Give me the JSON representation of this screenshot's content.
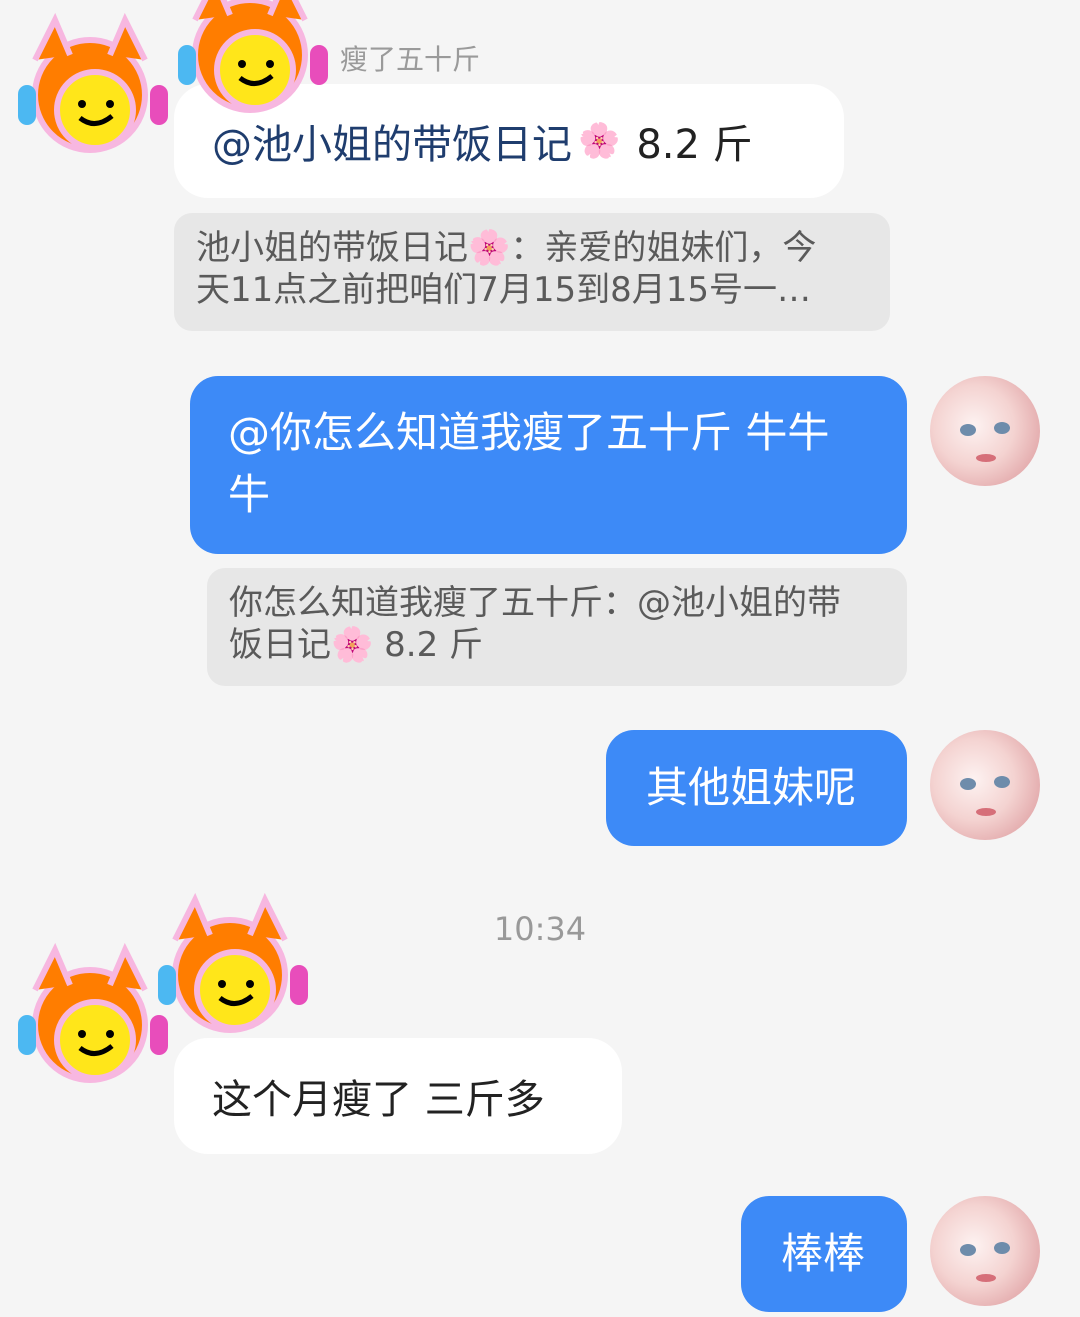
{
  "messages": {
    "top_snippet": "瘦了五十斤",
    "m1": {
      "mention": "@池小姐的带饭日记",
      "flower": "🌸",
      "value": "8.2 斤"
    },
    "q1": {
      "line1_pre": "池小姐的带饭日记",
      "flower": "🌸",
      "line1_post": "：亲爱的姐妹们，今",
      "line2": "天11点之前把咱们7月15到8月15号一…"
    },
    "m2": {
      "line1": "@你怎么知道我瘦了五十斤 牛牛",
      "line2": "牛"
    },
    "q2": {
      "line1": "你怎么知道我瘦了五十斤：@池小姐的带",
      "line2_pre": "饭日记",
      "flower": "🌸",
      "line2_post": " 8.2 斤"
    },
    "m3": {
      "text": "其他姐妹呢"
    },
    "timestamp": "10:34",
    "m4": {
      "text": "这个月瘦了 三斤多"
    },
    "m5": {
      "text": "棒棒"
    }
  },
  "colors": {
    "background": "#f5f5f5",
    "outgoing_bubble": "#3d8af7",
    "incoming_bubble": "#ffffff",
    "quote_bubble": "#e7e7e7"
  },
  "icons": {
    "sticker": "orange-hair-smiley-headphones-sticker",
    "avatar": "pink-anime-girl-avatar"
  }
}
